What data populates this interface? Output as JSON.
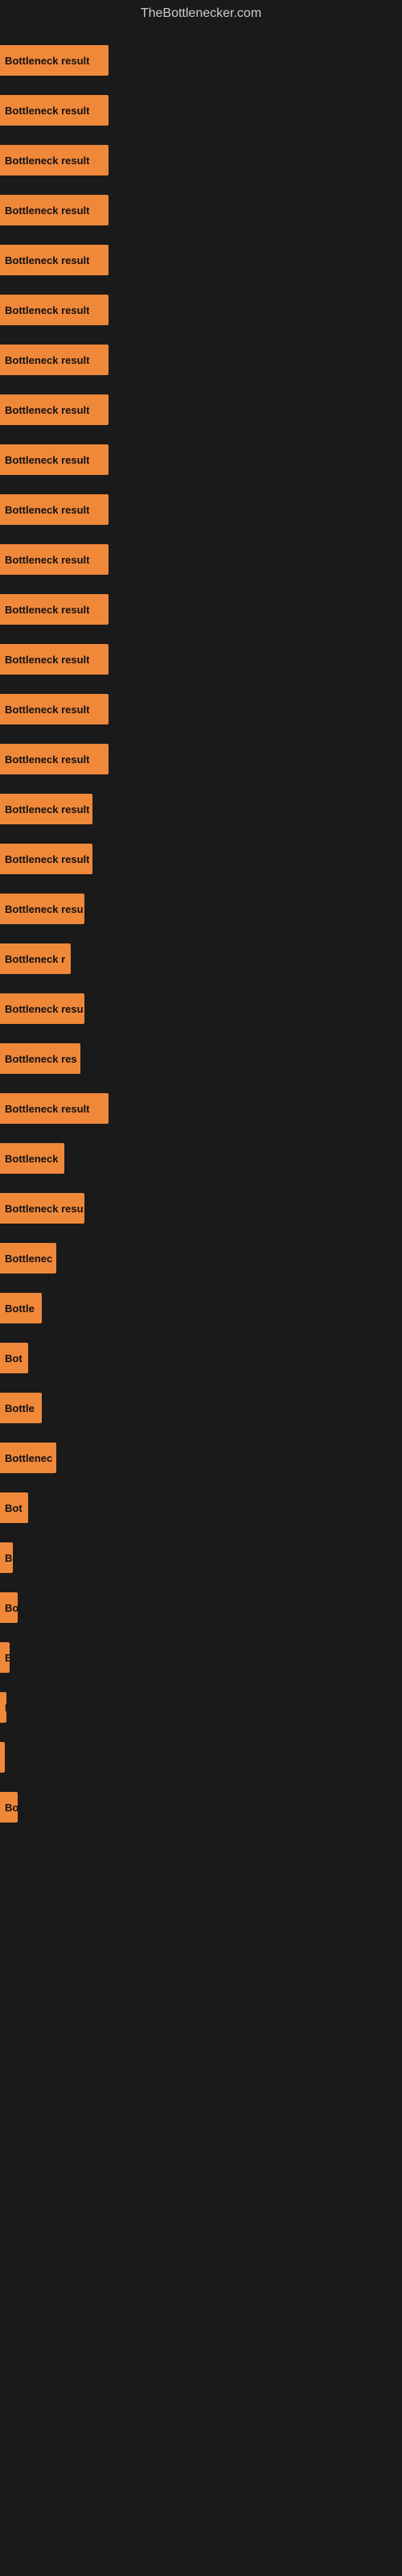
{
  "site": {
    "title": "TheBottlenecker.com"
  },
  "bars": [
    {
      "label": "Bottleneck result",
      "width": 135
    },
    {
      "label": "Bottleneck result",
      "width": 135
    },
    {
      "label": "Bottleneck result",
      "width": 135
    },
    {
      "label": "Bottleneck result",
      "width": 135
    },
    {
      "label": "Bottleneck result",
      "width": 135
    },
    {
      "label": "Bottleneck result",
      "width": 135
    },
    {
      "label": "Bottleneck result",
      "width": 135
    },
    {
      "label": "Bottleneck result",
      "width": 135
    },
    {
      "label": "Bottleneck result",
      "width": 135
    },
    {
      "label": "Bottleneck result",
      "width": 135
    },
    {
      "label": "Bottleneck result",
      "width": 135
    },
    {
      "label": "Bottleneck result",
      "width": 135
    },
    {
      "label": "Bottleneck result",
      "width": 135
    },
    {
      "label": "Bottleneck result",
      "width": 135
    },
    {
      "label": "Bottleneck result",
      "width": 135
    },
    {
      "label": "Bottleneck result",
      "width": 115
    },
    {
      "label": "Bottleneck result",
      "width": 115
    },
    {
      "label": "Bottleneck resu",
      "width": 105
    },
    {
      "label": "Bottleneck r",
      "width": 88
    },
    {
      "label": "Bottleneck resu",
      "width": 105
    },
    {
      "label": "Bottleneck res",
      "width": 100
    },
    {
      "label": "Bottleneck result",
      "width": 135
    },
    {
      "label": "Bottleneck",
      "width": 80
    },
    {
      "label": "Bottleneck resu",
      "width": 105
    },
    {
      "label": "Bottlenec",
      "width": 70
    },
    {
      "label": "Bottle",
      "width": 52
    },
    {
      "label": "Bot",
      "width": 35
    },
    {
      "label": "Bottle",
      "width": 52
    },
    {
      "label": "Bottlenec",
      "width": 70
    },
    {
      "label": "Bot",
      "width": 35
    },
    {
      "label": "B",
      "width": 16
    },
    {
      "label": "Bo",
      "width": 22
    },
    {
      "label": "B",
      "width": 12
    },
    {
      "label": "I",
      "width": 8
    },
    {
      "label": "",
      "width": 4
    },
    {
      "label": "Bo",
      "width": 22
    }
  ]
}
